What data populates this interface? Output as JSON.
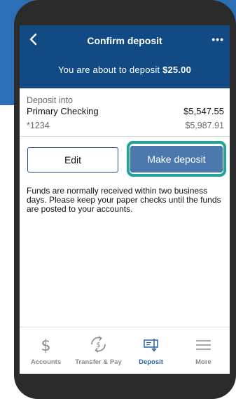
{
  "header": {
    "title": "Confirm deposit",
    "more_label": "•••",
    "sub_prefix": "You are about to deposit",
    "amount": "$25.00"
  },
  "deposit": {
    "into_label": "Deposit into",
    "account_name": "Primary Checking",
    "balance": "$5,547.55",
    "account_number": "*1234",
    "available": "$5,987.91"
  },
  "actions": {
    "edit_label": "Edit",
    "make_label": "Make deposit"
  },
  "note": "Funds are normally received within two business days. Please keep your paper checks until the funds are posted to your accounts.",
  "tabs": [
    {
      "label": "Accounts",
      "icon": "dollar-icon"
    },
    {
      "label": "Transfer & Pay",
      "icon": "transfer-icon"
    },
    {
      "label": "Deposit",
      "icon": "check-deposit-icon",
      "active": true
    },
    {
      "label": "More",
      "icon": "menu-icon"
    }
  ],
  "colors": {
    "navbar": "#124a84",
    "primary_button": "#4c79ad",
    "highlight_ring": "#1fa39a",
    "active_tab": "#2a63a6"
  }
}
